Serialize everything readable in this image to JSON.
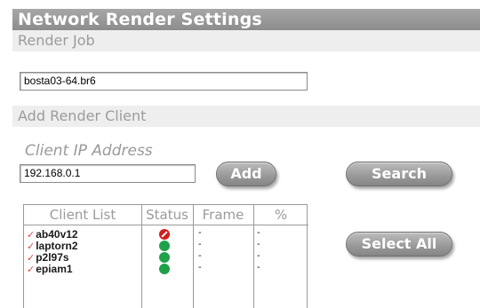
{
  "window": {
    "title": "Network Render Settings"
  },
  "render_job": {
    "section_label": "Render Job",
    "filename": "bosta03-64.br6"
  },
  "add_client": {
    "section_label": "Add Render Client",
    "ip_label": "Client IP Address",
    "ip_value": "192.168.0.1",
    "add_label": "Add",
    "search_label": "Search",
    "select_all_label": "Select All"
  },
  "client_table": {
    "headers": [
      "Client List",
      "Status",
      "Frame",
      "%"
    ],
    "rows": [
      {
        "name": "ab40v12",
        "status": "error",
        "frame": "-",
        "percent": "-"
      },
      {
        "name": "laptorn2",
        "status": "ok",
        "frame": "-",
        "percent": "-"
      },
      {
        "name": "p2l97s",
        "status": "ok",
        "frame": "-",
        "percent": "-"
      },
      {
        "name": "epiam1",
        "status": "ok",
        "frame": "-",
        "percent": "-"
      }
    ]
  },
  "colors": {
    "title_bar": "#8c8c8c",
    "section_bar": "#eeeeee",
    "status_ok": "#1fa14a",
    "status_error": "#d11f1f"
  },
  "icons": {
    "row_check": "checkmark-icon",
    "status_ok": "status-ok-icon",
    "status_error": "status-error-icon"
  }
}
